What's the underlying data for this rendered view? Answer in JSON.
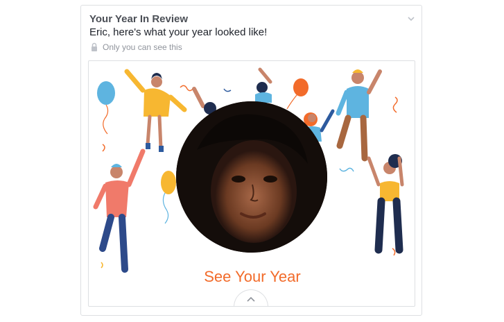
{
  "card": {
    "title": "Your Year In Review",
    "subtitle": "Eric, here's what your year looked like!",
    "privacy_text": "Only you can see this",
    "cta_label": "See Your Year"
  },
  "colors": {
    "cta": "#f26b2a",
    "title": "#4b4f56",
    "muted": "#90949c",
    "border": "#dddfe2"
  },
  "icons": [
    "lock-icon",
    "chevron-down-icon",
    "chevron-up-icon"
  ]
}
